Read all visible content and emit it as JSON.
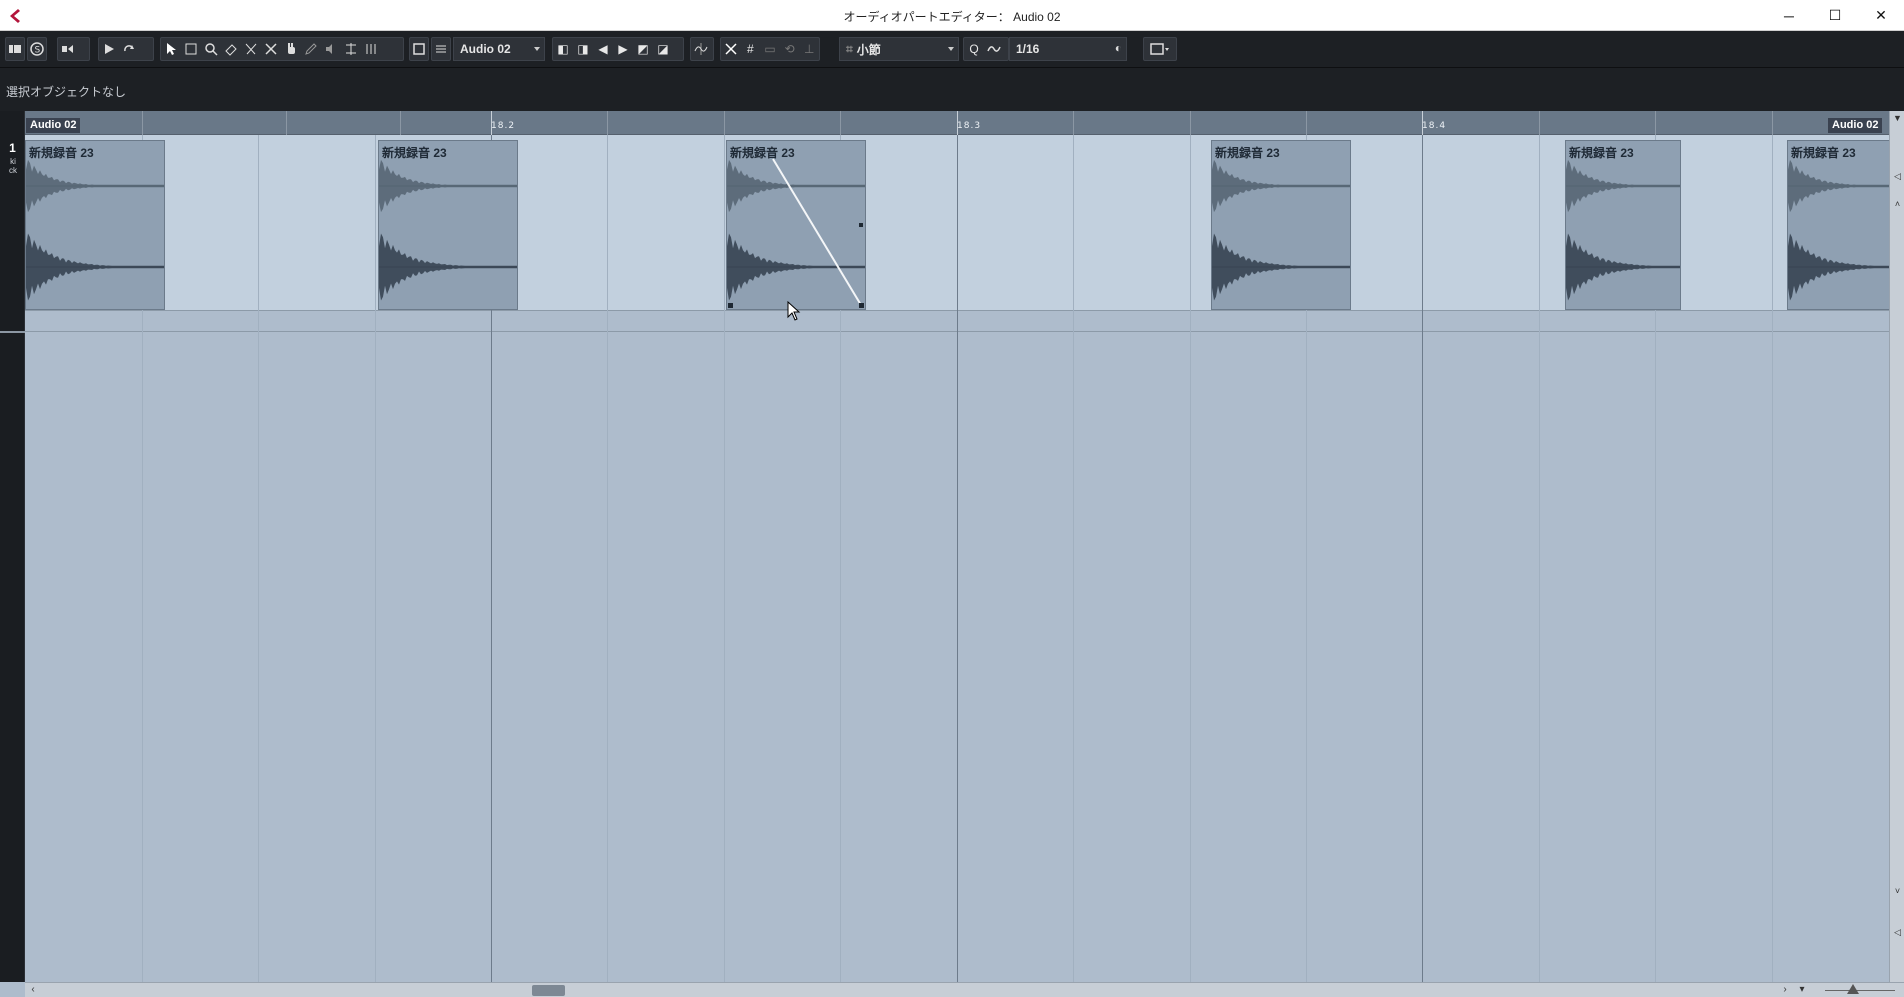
{
  "window": {
    "title": "オーディオパートエディター： Audio 02",
    "minimize": "─",
    "maximize": "☐",
    "close": "✕"
  },
  "toolbar": {
    "part_select": "Audio 02",
    "snap_type": "小節",
    "quantize": "1/16",
    "quantize_icon": "Q"
  },
  "info_line": {
    "text": "選択オブジェクトなし"
  },
  "ruler": {
    "part_label_left": "Audio 02",
    "part_label_right": "Audio 02",
    "labels": [
      "18.2",
      "18.3",
      "18.4"
    ]
  },
  "lane": {
    "number": "1",
    "name": "kick"
  },
  "events": [
    {
      "name": "新規録音 23"
    },
    {
      "name": "新規録音 23"
    },
    {
      "name": "新規録音 23"
    },
    {
      "name": "新規録音 23"
    },
    {
      "name": "新規録音 23"
    },
    {
      "name": "新規録音 23"
    }
  ],
  "colors": {
    "toolbar_bg": "#1d2024",
    "lane_bg": "#c2d0de",
    "event_bg": "#8fa0b2",
    "ruler_bg": "#697888"
  }
}
